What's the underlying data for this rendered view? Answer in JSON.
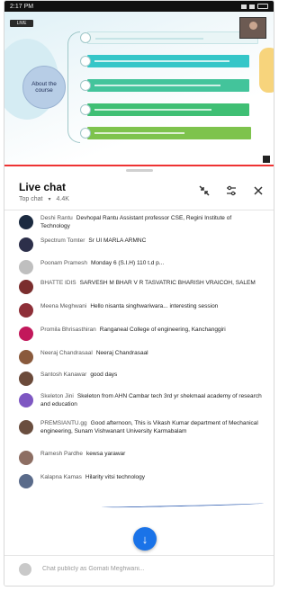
{
  "status_bar": {
    "time": "2:17 PM"
  },
  "video": {
    "live_tag": "LIVE",
    "slide_heading": "About the course",
    "progress": 1.0
  },
  "chat": {
    "title": "Live chat",
    "mode": "Top chat",
    "viewer_count": "4.4K",
    "input_placeholder": "Chat publicly as Gomati Meghwani...",
    "messages": [
      {
        "author": "Deshi Rantu",
        "text": "Devhopal Rantu Assistant professor CSE, Regini Institute of Technology",
        "avatar_color": "#1b2a40"
      },
      {
        "author": "Spectrum Tomter",
        "text": "Sr UI MARLA ARMNC",
        "avatar_color": "#2c2f4a"
      },
      {
        "author": "Poonam Pramesh",
        "text": "Monday 6 (S.I.H) 110 t.d p...",
        "avatar_color": "#bfbfbf"
      },
      {
        "author": "BHATTE IDIS",
        "text": "SARVESH M BHAR V R TASVATRIC BHARISH VRAICOH, SALEM",
        "avatar_color": "#7b2e2e"
      },
      {
        "author": "Meena Meghwani",
        "text": "Hello nisanta singhwariwara... interesting session",
        "avatar_color": "#8e2f38"
      },
      {
        "author": "Promila Bhrisasthiran",
        "text": "Ranganeal College of engineering, Kanchanggiri",
        "avatar_color": "#c2185b"
      },
      {
        "author": "Neeraj Chandrasaal",
        "text": "Neeraj Chandrasaal",
        "avatar_color": "#8a5a3c"
      },
      {
        "author": "Santosh Kanawar",
        "text": "good days",
        "avatar_color": "#6b4a3a"
      },
      {
        "author": "Skeleton Jini",
        "text": "Skeleton from AHN Cambar tech 3rd yr shekmaal academy of research and education",
        "avatar_color": "#7e57c2"
      },
      {
        "author": "PREMSIANTU.gg",
        "text": "Good afternoon, This is Vikash Kumar department of Mechanical engineering, Sunam Vishwanant University Karmabalam",
        "avatar_color": "#6a4e3f"
      },
      {
        "author": "Ramesh Pardhe",
        "text": "kewsa yarawar",
        "avatar_color": "#8d6e63"
      },
      {
        "author": "Kalapna Kamas",
        "text": "Hilarity vitsi technology",
        "avatar_color": "#5a6b8a"
      }
    ]
  }
}
